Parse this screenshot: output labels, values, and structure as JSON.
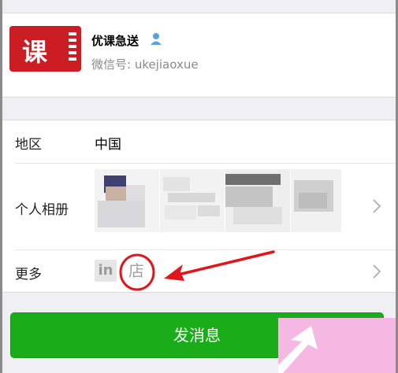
{
  "profile": {
    "avatar_char": "课",
    "name": "优课急送",
    "wechat_id": "微信号: ukejiaoxue"
  },
  "rows": {
    "region_label": "地区",
    "region_value": "中国",
    "album_label": "个人相册",
    "more_label": "更多",
    "in_badge": "in",
    "shop_badge": "店"
  },
  "actions": {
    "send_label": "发消息"
  },
  "colors": {
    "accent_green": "#1aad19",
    "avatar_red": "#cc1d25",
    "annotation_red": "#e0161c",
    "watermark_pink": "#f4b8e3"
  }
}
